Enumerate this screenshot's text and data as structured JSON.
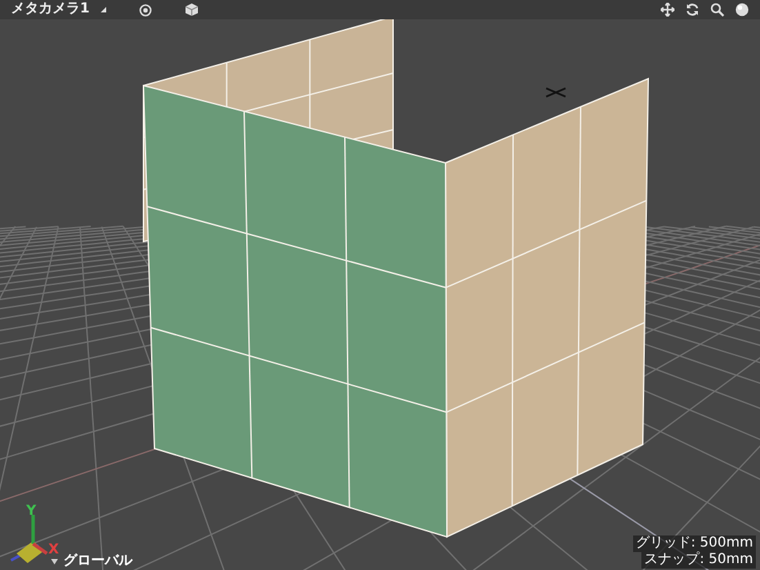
{
  "toolbar": {
    "camera_label": "メタカメラ1"
  },
  "viewport": {
    "axis_labels": [
      "Y",
      "X"
    ],
    "coordinate_mode": "グローバル",
    "grid": "グリッド: 500mm",
    "snap": "スナップ: 50mm"
  }
}
